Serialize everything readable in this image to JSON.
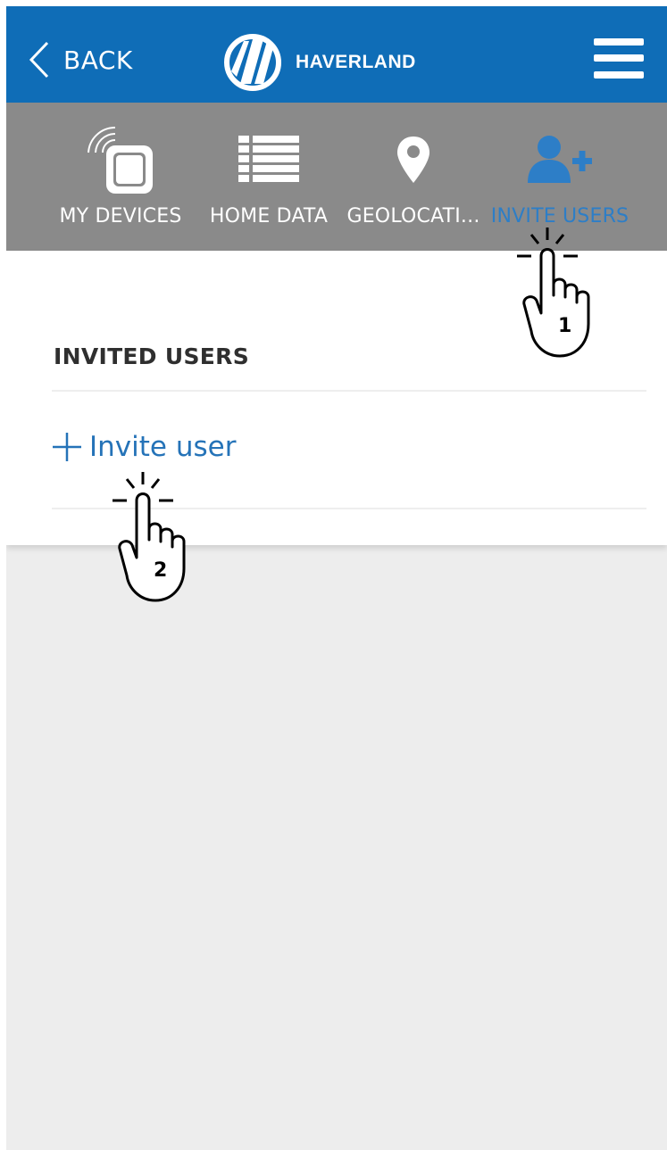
{
  "header": {
    "back_label": "BACK",
    "logo_text": "HAVERLAND",
    "colors": {
      "bar": "#0f6db7",
      "text": "#ffffff"
    }
  },
  "tabs": [
    {
      "label": "MY DEVICES",
      "icon": "device-wifi-icon",
      "active": false
    },
    {
      "label": "HOME DATA",
      "icon": "list-icon",
      "active": false
    },
    {
      "label": "GEOLOCATI...",
      "icon": "location-pin-icon",
      "active": false
    },
    {
      "label": "INVITE USERS",
      "icon": "add-user-icon",
      "active": true
    }
  ],
  "tab_colors": {
    "bar": "#8a8a8a",
    "text": "#ffffff",
    "active": "#2d7ec7"
  },
  "invited_users": {
    "title": "INVITED USERS",
    "invite_label": "Invite user",
    "invite_icon": "plus-icon"
  },
  "annotations": [
    {
      "label": "1",
      "icon": "tap-hand-icon"
    },
    {
      "label": "2",
      "icon": "tap-hand-icon"
    }
  ]
}
